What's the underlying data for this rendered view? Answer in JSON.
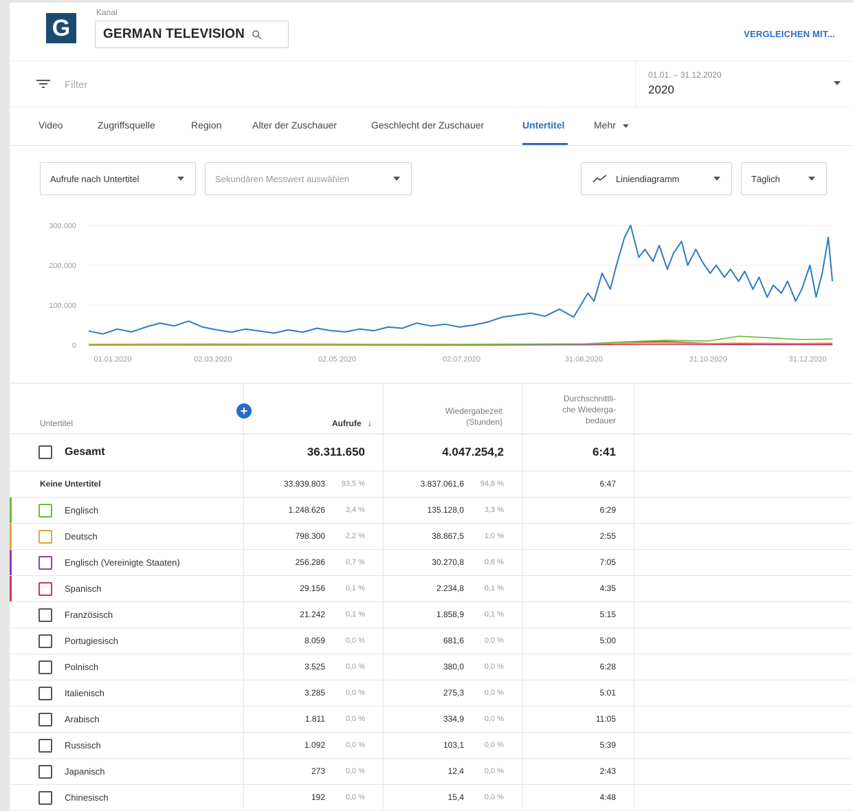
{
  "header": {
    "logo_letter": "G",
    "channel_caption": "Kanal",
    "channel_name": "GERMAN TELEVISION",
    "compare_link": "VERGLEICHEN MIT..."
  },
  "filter": {
    "placeholder": "Filter",
    "date_range": "01.01. – 31.12.2020",
    "date_value": "2020"
  },
  "tabs": [
    "Video",
    "Zugriffsquelle",
    "Region",
    "Alter der Zuschauer",
    "Geschlecht der Zuschauer",
    "Untertitel",
    "Mehr"
  ],
  "active_tab": "Untertitel",
  "controls": {
    "metric": "Aufrufe nach Untertitel",
    "secondary_metric": "Sekundären Messwert auswählen",
    "chart_type": "Liniendiagramm",
    "granularity": "Täglich"
  },
  "colors": {
    "accent": "#2a6cc4",
    "series_total": "#2c7bc4",
    "series_english": "#72b93a",
    "series_german": "#e8a23a",
    "series_english_us": "#8a3fbf",
    "series_spanish": "#d0354f"
  },
  "chart_data": {
    "type": "line",
    "x_ticks": [
      "01.01.2020",
      "02.03.2020",
      "02.05.2020",
      "02.07.2020",
      "31.08.2020",
      "31.10.2020",
      "31.12.2020"
    ],
    "y_ticks": [
      "300.000",
      "200.000",
      "100.000",
      "0"
    ],
    "ylim": [
      0,
      300000
    ],
    "grid": true,
    "series": [
      {
        "color": "#2c7bc4",
        "x": [
          "01.01.2020",
          "08.01.2020",
          "15.01.2020",
          "22.01.2020",
          "29.01.2020",
          "05.02.2020",
          "12.02.2020",
          "19.02.2020",
          "26.02.2020",
          "04.03.2020",
          "11.03.2020",
          "18.03.2020",
          "25.03.2020",
          "01.04.2020",
          "08.04.2020",
          "15.04.2020",
          "22.04.2020",
          "29.04.2020",
          "06.05.2020",
          "13.05.2020",
          "20.05.2020",
          "27.05.2020",
          "03.06.2020",
          "10.06.2020",
          "17.06.2020",
          "24.06.2020",
          "01.07.2020",
          "08.07.2020",
          "15.07.2020",
          "22.07.2020",
          "29.07.2020",
          "05.08.2020",
          "12.08.2020",
          "19.08.2020",
          "26.08.2020",
          "02.09.2020",
          "05.09.2020",
          "09.09.2020",
          "13.09.2020",
          "16.09.2020",
          "20.09.2020",
          "23.09.2020",
          "27.09.2020",
          "30.09.2020",
          "04.10.2020",
          "07.10.2020",
          "11.10.2020",
          "14.10.2020",
          "18.10.2020",
          "21.10.2020",
          "25.10.2020",
          "28.10.2020",
          "01.11.2020",
          "04.11.2020",
          "08.11.2020",
          "11.11.2020",
          "15.11.2020",
          "18.11.2020",
          "22.11.2020",
          "25.11.2020",
          "29.11.2020",
          "02.12.2020",
          "06.12.2020",
          "09.12.2020",
          "13.12.2020",
          "16.12.2020",
          "20.12.2020",
          "23.12.2020",
          "26.12.2020",
          "29.12.2020",
          "31.12.2020"
        ],
        "values": [
          35000,
          28000,
          40000,
          33000,
          45000,
          55000,
          48000,
          60000,
          45000,
          38000,
          32000,
          40000,
          35000,
          30000,
          38000,
          32000,
          42000,
          36000,
          33000,
          40000,
          36000,
          45000,
          42000,
          55000,
          48000,
          52000,
          45000,
          50000,
          58000,
          70000,
          75000,
          80000,
          72000,
          90000,
          70000,
          130000,
          110000,
          180000,
          140000,
          200000,
          270000,
          300000,
          220000,
          240000,
          210000,
          250000,
          190000,
          230000,
          260000,
          200000,
          240000,
          210000,
          180000,
          200000,
          170000,
          190000,
          160000,
          185000,
          140000,
          170000,
          120000,
          150000,
          130000,
          160000,
          110000,
          140000,
          200000,
          120000,
          180000,
          270000,
          160000
        ]
      },
      {
        "color": "#72b93a",
        "x": [
          "01.01.2020",
          "01.03.2020",
          "01.05.2020",
          "01.07.2020",
          "31.08.2020",
          "20.09.2020",
          "10.10.2020",
          "31.10.2020",
          "15.11.2020",
          "01.12.2020",
          "15.12.2020",
          "31.12.2020"
        ],
        "values": [
          0,
          0,
          0,
          1000,
          3000,
          8000,
          12000,
          10000,
          22000,
          18000,
          14000,
          15000
        ]
      },
      {
        "color": "#e8a23a",
        "x": [
          "01.01.2020",
          "01.03.2020",
          "01.05.2020",
          "01.07.2020",
          "31.08.2020",
          "20.09.2020",
          "10.10.2020",
          "31.10.2020",
          "15.11.2020",
          "01.12.2020",
          "15.12.2020",
          "31.12.2020"
        ],
        "values": [
          2000,
          3000,
          2500,
          2000,
          3000,
          5000,
          6000,
          4000,
          5000,
          4500,
          4000,
          5000
        ]
      },
      {
        "color": "#8a3fbf",
        "x": [
          "01.01.2020",
          "01.03.2020",
          "01.05.2020",
          "01.07.2020",
          "31.08.2020",
          "20.09.2020",
          "10.10.2020",
          "31.10.2020",
          "15.11.2020",
          "01.12.2020",
          "15.12.2020",
          "31.12.2020"
        ],
        "values": [
          0,
          0,
          0,
          0,
          1000,
          6000,
          9000,
          4000,
          3000,
          2000,
          3000,
          4000
        ]
      },
      {
        "color": "#d0354f",
        "x": [
          "01.01.2020",
          "01.03.2020",
          "01.05.2020",
          "01.07.2020",
          "31.08.2020",
          "20.09.2020",
          "10.10.2020",
          "31.10.2020",
          "15.11.2020",
          "01.12.2020",
          "15.12.2020",
          "31.12.2020"
        ],
        "values": [
          0,
          0,
          0,
          0,
          500,
          1500,
          2000,
          1500,
          1000,
          800,
          900,
          1000
        ]
      }
    ]
  },
  "table": {
    "headers": {
      "subtitle": "Untertitel",
      "views": "Aufrufe",
      "watch_time": [
        "Wiedergabezeit",
        "(Stunden)"
      ],
      "avg_duration": [
        "Durchschnittli-",
        "che Wiederga-",
        "bedauer"
      ]
    },
    "total": {
      "label": "Gesamt",
      "views": "36.311.650",
      "watch_time": "4.047.254,2",
      "avg": "6:41"
    },
    "rows": [
      {
        "label": "Keine Untertitel",
        "views": "33.939.803",
        "views_pct": "93,5 %",
        "watch": "3.837.061,6",
        "watch_pct": "94,8 %",
        "avg": "6:47",
        "checkbox": false,
        "color": ""
      },
      {
        "label": "Englisch",
        "views": "1.248.626",
        "views_pct": "3,4 %",
        "watch": "135.128,0",
        "watch_pct": "3,3 %",
        "avg": "6:29",
        "checkbox": true,
        "color": "#72b93a"
      },
      {
        "label": "Deutsch",
        "views": "798.300",
        "views_pct": "2,2 %",
        "watch": "38.867,5",
        "watch_pct": "1,0 %",
        "avg": "2:55",
        "checkbox": true,
        "color": "#e8a23a"
      },
      {
        "label": "Englisch (Vereinigte Staaten)",
        "views": "256.286",
        "views_pct": "0,7 %",
        "watch": "30.270,8",
        "watch_pct": "0,8 %",
        "avg": "7:05",
        "checkbox": true,
        "color": "#8a3fbf"
      },
      {
        "label": "Spanisch",
        "views": "29.156",
        "views_pct": "0,1 %",
        "watch": "2.234,8",
        "watch_pct": "0,1 %",
        "avg": "4:35",
        "checkbox": true,
        "color": "#d0354f"
      },
      {
        "label": "Französisch",
        "views": "21.242",
        "views_pct": "0,1 %",
        "watch": "1.858,9",
        "watch_pct": "0,1 %",
        "avg": "5:15",
        "checkbox": true,
        "color": ""
      },
      {
        "label": "Portugiesisch",
        "views": "8.059",
        "views_pct": "0,0 %",
        "watch": "681,6",
        "watch_pct": "0,0 %",
        "avg": "5:00",
        "checkbox": true,
        "color": ""
      },
      {
        "label": "Polnisch",
        "views": "3.525",
        "views_pct": "0,0 %",
        "watch": "380,0",
        "watch_pct": "0,0 %",
        "avg": "6:28",
        "checkbox": true,
        "color": ""
      },
      {
        "label": "Italienisch",
        "views": "3.285",
        "views_pct": "0,0 %",
        "watch": "275,3",
        "watch_pct": "0,0 %",
        "avg": "5:01",
        "checkbox": true,
        "color": ""
      },
      {
        "label": "Arabisch",
        "views": "1.811",
        "views_pct": "0,0 %",
        "watch": "334,9",
        "watch_pct": "0,0 %",
        "avg": "11:05",
        "checkbox": true,
        "color": ""
      },
      {
        "label": "Russisch",
        "views": "1.092",
        "views_pct": "0,0 %",
        "watch": "103,1",
        "watch_pct": "0,0 %",
        "avg": "5:39",
        "checkbox": true,
        "color": ""
      },
      {
        "label": "Japanisch",
        "views": "273",
        "views_pct": "0,0 %",
        "watch": "12,4",
        "watch_pct": "0,0 %",
        "avg": "2:43",
        "checkbox": true,
        "color": ""
      },
      {
        "label": "Chinesisch",
        "views": "192",
        "views_pct": "0,0 %",
        "watch": "15,4",
        "watch_pct": "0,0 %",
        "avg": "4:48",
        "checkbox": true,
        "color": ""
      }
    ]
  }
}
